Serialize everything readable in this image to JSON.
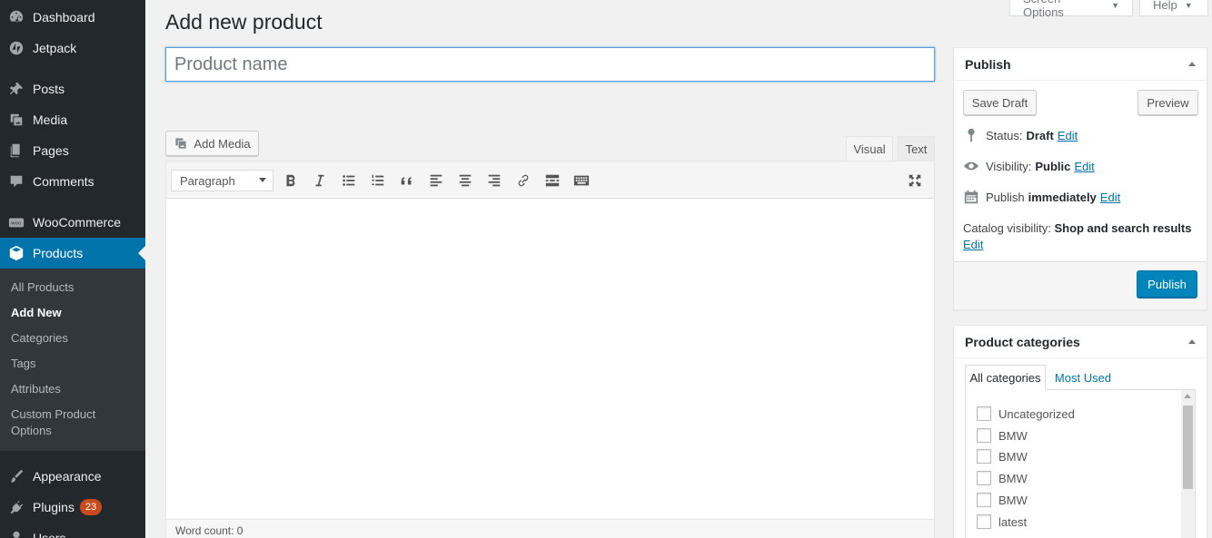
{
  "sidebar": {
    "items": [
      {
        "label": "Dashboard",
        "icon": "dashboard-icon"
      },
      {
        "label": "Jetpack",
        "icon": "jetpack-icon"
      },
      {
        "label": "Posts",
        "icon": "pin-icon"
      },
      {
        "label": "Media",
        "icon": "media-icon"
      },
      {
        "label": "Pages",
        "icon": "pages-icon"
      },
      {
        "label": "Comments",
        "icon": "comment-icon"
      },
      {
        "label": "WooCommerce",
        "icon": "woo-icon"
      },
      {
        "label": "Products",
        "icon": "box-icon"
      },
      {
        "label": "Appearance",
        "icon": "brush-icon"
      },
      {
        "label": "Plugins",
        "icon": "plugin-icon",
        "badge": "23"
      },
      {
        "label": "Users",
        "icon": "users-icon"
      }
    ],
    "submenu": [
      "All Products",
      "Add New",
      "Categories",
      "Tags",
      "Attributes",
      "Custom Product",
      "Options"
    ]
  },
  "top_tabs": {
    "screen_options": "Screen Options",
    "help": "Help"
  },
  "page_title": "Add new product",
  "title_input": {
    "placeholder": "Product name",
    "value": ""
  },
  "editor": {
    "add_media": "Add Media",
    "tab_visual": "Visual",
    "tab_text": "Text",
    "format_select": "Paragraph",
    "word_count": "Word count: 0"
  },
  "publish_box": {
    "title": "Publish",
    "save_draft": "Save Draft",
    "preview": "Preview",
    "status_label": "Status:",
    "status_value": "Draft",
    "visibility_label": "Visibility:",
    "visibility_value": "Public",
    "publish_label": "Publish",
    "publish_value": "immediately",
    "catalog_label": "Catalog visibility:",
    "catalog_value": "Shop and search results",
    "edit": "Edit",
    "publish_button": "Publish"
  },
  "categories_box": {
    "title": "Product categories",
    "tab_all": "All categories",
    "tab_used": "Most Used",
    "items": [
      "Uncategorized",
      "BMW",
      "BMW",
      "BMW",
      "BMW",
      "latest"
    ]
  },
  "colors": {
    "accent": "#0073aa",
    "sidebar": "#23282d",
    "publish_button": "#0085ba",
    "badge": "#ca4a1f"
  }
}
